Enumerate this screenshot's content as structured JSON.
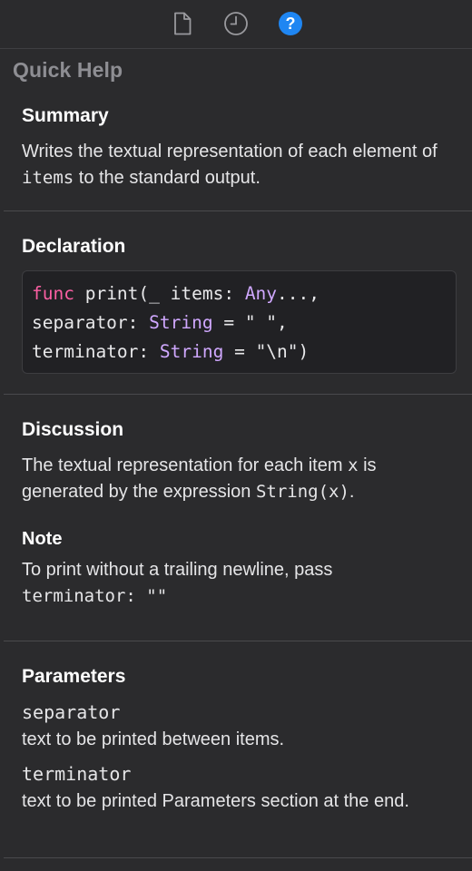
{
  "toolbar": {
    "icons": [
      {
        "name": "file-icon",
        "active": false
      },
      {
        "name": "history-clock-icon",
        "active": false
      },
      {
        "name": "quick-help-icon",
        "active": true
      }
    ],
    "accent_color": "#1f86f2"
  },
  "panel": {
    "title": "Quick Help"
  },
  "summary": {
    "heading": "Summary",
    "text_part1": "Writes the textual representation of each element of ",
    "text_code": "items",
    "text_part2": " to the standard output."
  },
  "declaration": {
    "heading": "Declaration",
    "line1": {
      "kw": "func",
      "plain1": " print(_ items: ",
      "type": "Any",
      "plain2": "...,"
    },
    "line2": {
      "plain1": "separator: ",
      "type": "String",
      "plain2": " = \" \","
    },
    "line3": {
      "plain1": "terminator: ",
      "type": "String",
      "plain2": " = \"\\n\")"
    }
  },
  "discussion": {
    "heading": "Discussion",
    "text_part1": "The textual representation for each item ",
    "text_code1": "x",
    "text_part2": " is generated by the expression ",
    "text_code2": "String(x)",
    "text_part3": ".",
    "note_heading": "Note",
    "note_text": "To print without a trailing newline, pass",
    "note_code": "terminator: \"\""
  },
  "parameters": {
    "heading": "Parameters",
    "items": [
      {
        "name": "separator",
        "desc": "text to be printed between items."
      },
      {
        "name": "terminator",
        "desc": "text to be printed Parameters section at the end."
      }
    ]
  }
}
